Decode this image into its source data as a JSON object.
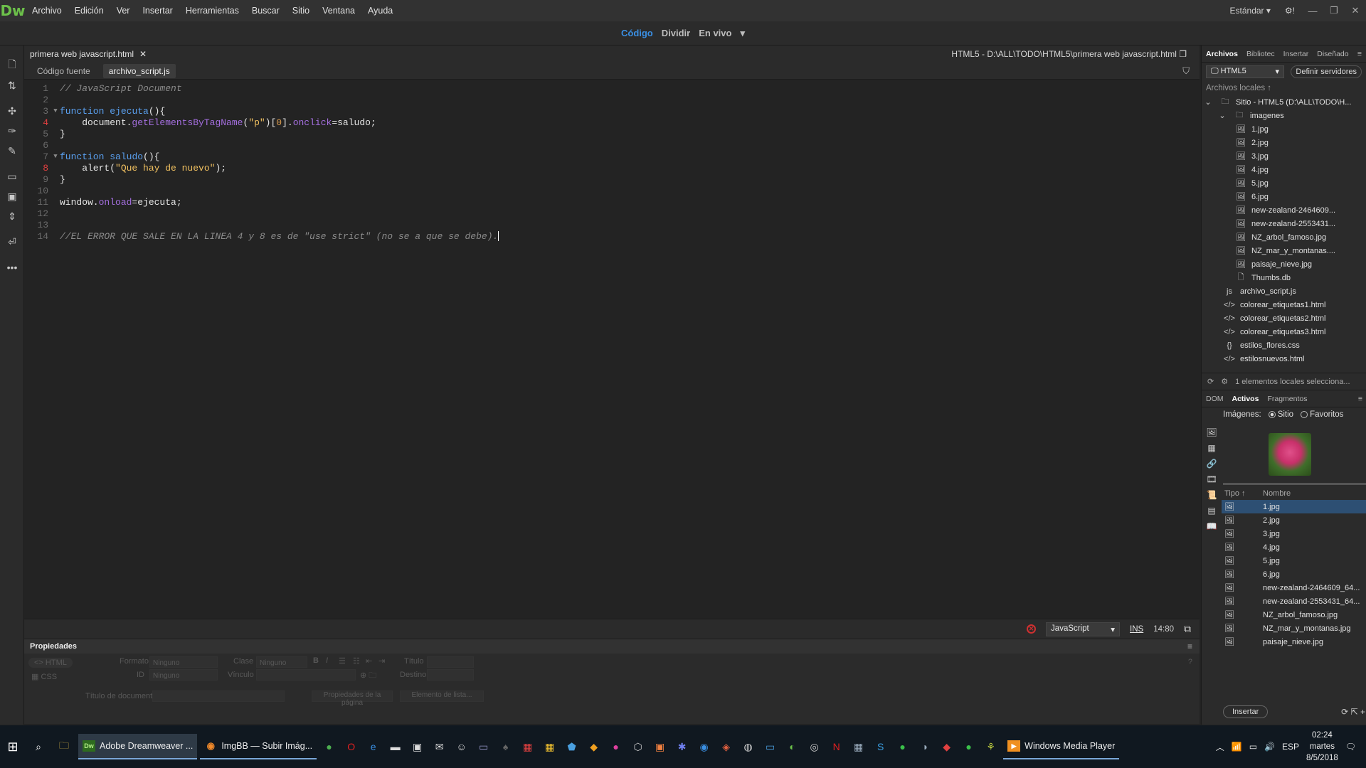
{
  "app": {
    "logo": "Dw"
  },
  "menu": [
    "Archivo",
    "Edición",
    "Ver",
    "Insertar",
    "Herramientas",
    "Buscar",
    "Sitio",
    "Ventana",
    "Ayuda"
  ],
  "workspace": {
    "label": "Estándar",
    "gear": "⚙!"
  },
  "views": {
    "code": "Código",
    "split": "Dividir",
    "live": "En vivo"
  },
  "document": {
    "tab": "primera web javascript.html",
    "path": "HTML5 - D:\\ALL\\TODO\\HTML5\\primera web javascript.html",
    "related": [
      "Código fuente",
      "archivo_script.js"
    ]
  },
  "code_lines": [
    {
      "n": "1",
      "err": false,
      "fold": "",
      "html": "<span class='cmt'>// JavaScript Document</span>"
    },
    {
      "n": "2",
      "err": false,
      "fold": "",
      "html": ""
    },
    {
      "n": "3",
      "err": false,
      "fold": "▼",
      "html": "<span class='kw'>function</span> <span class='kw'>ejecuta</span>(){"
    },
    {
      "n": "4",
      "err": true,
      "fold": "",
      "html": "    document.<span class='fn'>getElementsByTagName</span>(<span class='str'>\"p\"</span>)[<span class='num'>0</span>].<span class='fn'>onclick</span>=saludo;"
    },
    {
      "n": "5",
      "err": false,
      "fold": "",
      "html": "}"
    },
    {
      "n": "6",
      "err": false,
      "fold": "",
      "html": ""
    },
    {
      "n": "7",
      "err": false,
      "fold": "▼",
      "html": "<span class='kw'>function</span> <span class='kw'>saludo</span>(){"
    },
    {
      "n": "8",
      "err": true,
      "fold": "",
      "html": "    alert(<span class='str'>\"Que hay de nuevo\"</span>);"
    },
    {
      "n": "9",
      "err": false,
      "fold": "",
      "html": "}"
    },
    {
      "n": "10",
      "err": false,
      "fold": "",
      "html": ""
    },
    {
      "n": "11",
      "err": false,
      "fold": "",
      "html": "window.<span class='fn'>onload</span>=ejecuta;"
    },
    {
      "n": "12",
      "err": false,
      "fold": "",
      "html": ""
    },
    {
      "n": "13",
      "err": false,
      "fold": "",
      "html": ""
    },
    {
      "n": "14",
      "err": false,
      "fold": "",
      "html": "<span class='cmt'>//EL ERROR QUE SALE EN LA LINEA 4 y 8 es de \"use strict\" (no se a que se debe).</span><span class='cursor'></span>"
    }
  ],
  "status": {
    "language": "JavaScript",
    "mode": "INS",
    "position": "14:80"
  },
  "properties": {
    "title": "Propiedades",
    "html": "HTML",
    "css": "CSS",
    "format_label": "Formato",
    "format_value": "Ninguno",
    "class_label": "Clase",
    "class_value": "Ninguno",
    "id_label": "ID",
    "id_value": "Ninguno",
    "link_label": "Vínculo",
    "title_label": "Título",
    "target_label": "Destino",
    "doc_title": "Título de documento",
    "page_props": "Propiedades de la página",
    "list_item": "Elemento de lista..."
  },
  "files_panel": {
    "tabs": [
      "Archivos",
      "Bibliotec",
      "Insertar",
      "Diseñado"
    ],
    "site": "HTML5",
    "define_servers": "Definir servidores",
    "local_files": "Archivos locales ↑",
    "root": "Sitio - HTML5 (D:\\ALL\\TODO\\H...",
    "folder": "imagenes",
    "images": [
      "1.jpg",
      "2.jpg",
      "3.jpg",
      "4.jpg",
      "5.jpg",
      "6.jpg",
      "new-zealand-2464609...",
      "new-zealand-2553431...",
      "NZ_arbol_famoso.jpg",
      "NZ_mar_y_montanas....",
      "paisaje_nieve.jpg",
      "Thumbs.db"
    ],
    "files": [
      {
        "icon": "js",
        "name": "archivo_script.js"
      },
      {
        "icon": "</>",
        "name": "colorear_etiquetas1.html"
      },
      {
        "icon": "</>",
        "name": "colorear_etiquetas2.html"
      },
      {
        "icon": "</>",
        "name": "colorear_etiquetas3.html"
      },
      {
        "icon": "{}",
        "name": "estilos_flores.css"
      },
      {
        "icon": "</>",
        "name": "estilosnuevos.html"
      }
    ],
    "footer": "1 elementos locales selecciona..."
  },
  "assets_panel": {
    "tabs": [
      "DOM",
      "Activos",
      "Fragmentos"
    ],
    "images_label": "Imágenes:",
    "radio_site": "Sitio",
    "radio_fav": "Favoritos",
    "col_type": "Tipo ↑",
    "col_name": "Nombre",
    "items": [
      "1.jpg",
      "2.jpg",
      "3.jpg",
      "4.jpg",
      "5.jpg",
      "6.jpg",
      "new-zealand-2464609_64...",
      "new-zealand-2553431_64...",
      "NZ_arbol_famoso.jpg",
      "NZ_mar_y_montanas.jpg",
      "paisaje_nieve.jpg"
    ],
    "insert": "Insertar"
  },
  "taskbar": {
    "apps": [
      {
        "badge": "Dw",
        "label": "Adobe Dreamweaver ...",
        "active": true
      },
      {
        "badge": "◉",
        "label": "ImgBB — Subir Imág...",
        "active": false
      },
      {
        "badge": "▶",
        "label": "Windows Media Player",
        "active": false
      }
    ],
    "lang": "ESP",
    "time": "02:24",
    "day": "martes",
    "date": "8/5/2018"
  },
  "colors": {
    "accent": "#3a8fe3",
    "error": "#d03030",
    "dw_green": "#6cc04a"
  }
}
